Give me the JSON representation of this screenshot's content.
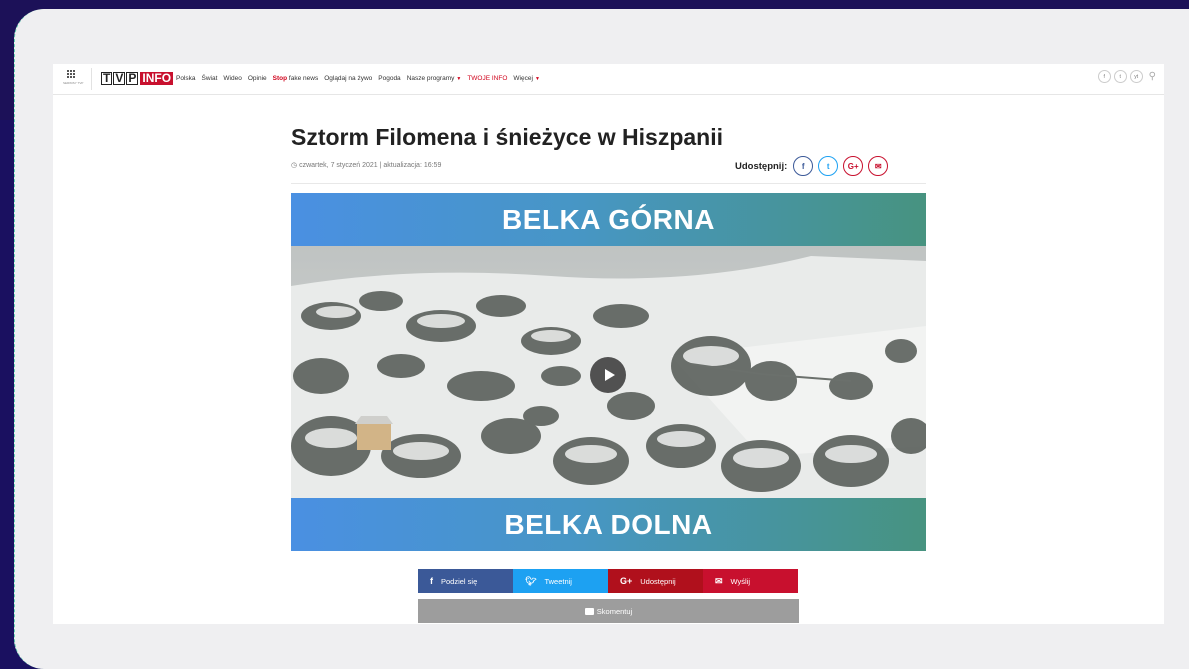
{
  "header": {
    "apps_label": "SERWISY TVP",
    "logo": {
      "letters": [
        "T",
        "V",
        "P"
      ],
      "box": "INFO"
    },
    "nav": [
      {
        "label": "Polska",
        "style": "normal"
      },
      {
        "label": "Świat",
        "style": "normal"
      },
      {
        "label": "Wideo",
        "style": "normal"
      },
      {
        "label": "Opinie",
        "style": "normal"
      },
      {
        "label": "fake news",
        "prefix": "Stop",
        "style": "stop"
      },
      {
        "label": "Oglądaj na żywo",
        "style": "normal"
      },
      {
        "label": "Pogoda",
        "style": "normal"
      },
      {
        "label": "Nasze programy",
        "style": "dropdown"
      },
      {
        "label": "TWOJE INFO",
        "style": "red"
      },
      {
        "label": "Więcej",
        "style": "dropdown"
      }
    ],
    "social": [
      "f",
      "t",
      "yt"
    ],
    "search_icon": "search-icon"
  },
  "article": {
    "title": "Sztorm Filomena i śnieżyce w Hiszpanii",
    "meta": "czwartek, 7 styczeń 2021 | aktualizacja: 16:59",
    "share_label": "Udostępnij:",
    "share_icons": [
      "f",
      "t",
      "G+",
      "✉"
    ]
  },
  "belka": {
    "top": "BELKA GÓRNA",
    "bottom": "BELKA DOLNA"
  },
  "share_buttons": {
    "facebook": "Podziel się",
    "twitter": "Tweetnij",
    "googleplus": "Udostępnij",
    "email": "Wyślij",
    "comment": "Skomentuj"
  },
  "colors": {
    "brand_red": "#c8102e",
    "belka_left": "#4a90e2",
    "belka_right": "#479380",
    "background_dark": "#1c1158"
  }
}
